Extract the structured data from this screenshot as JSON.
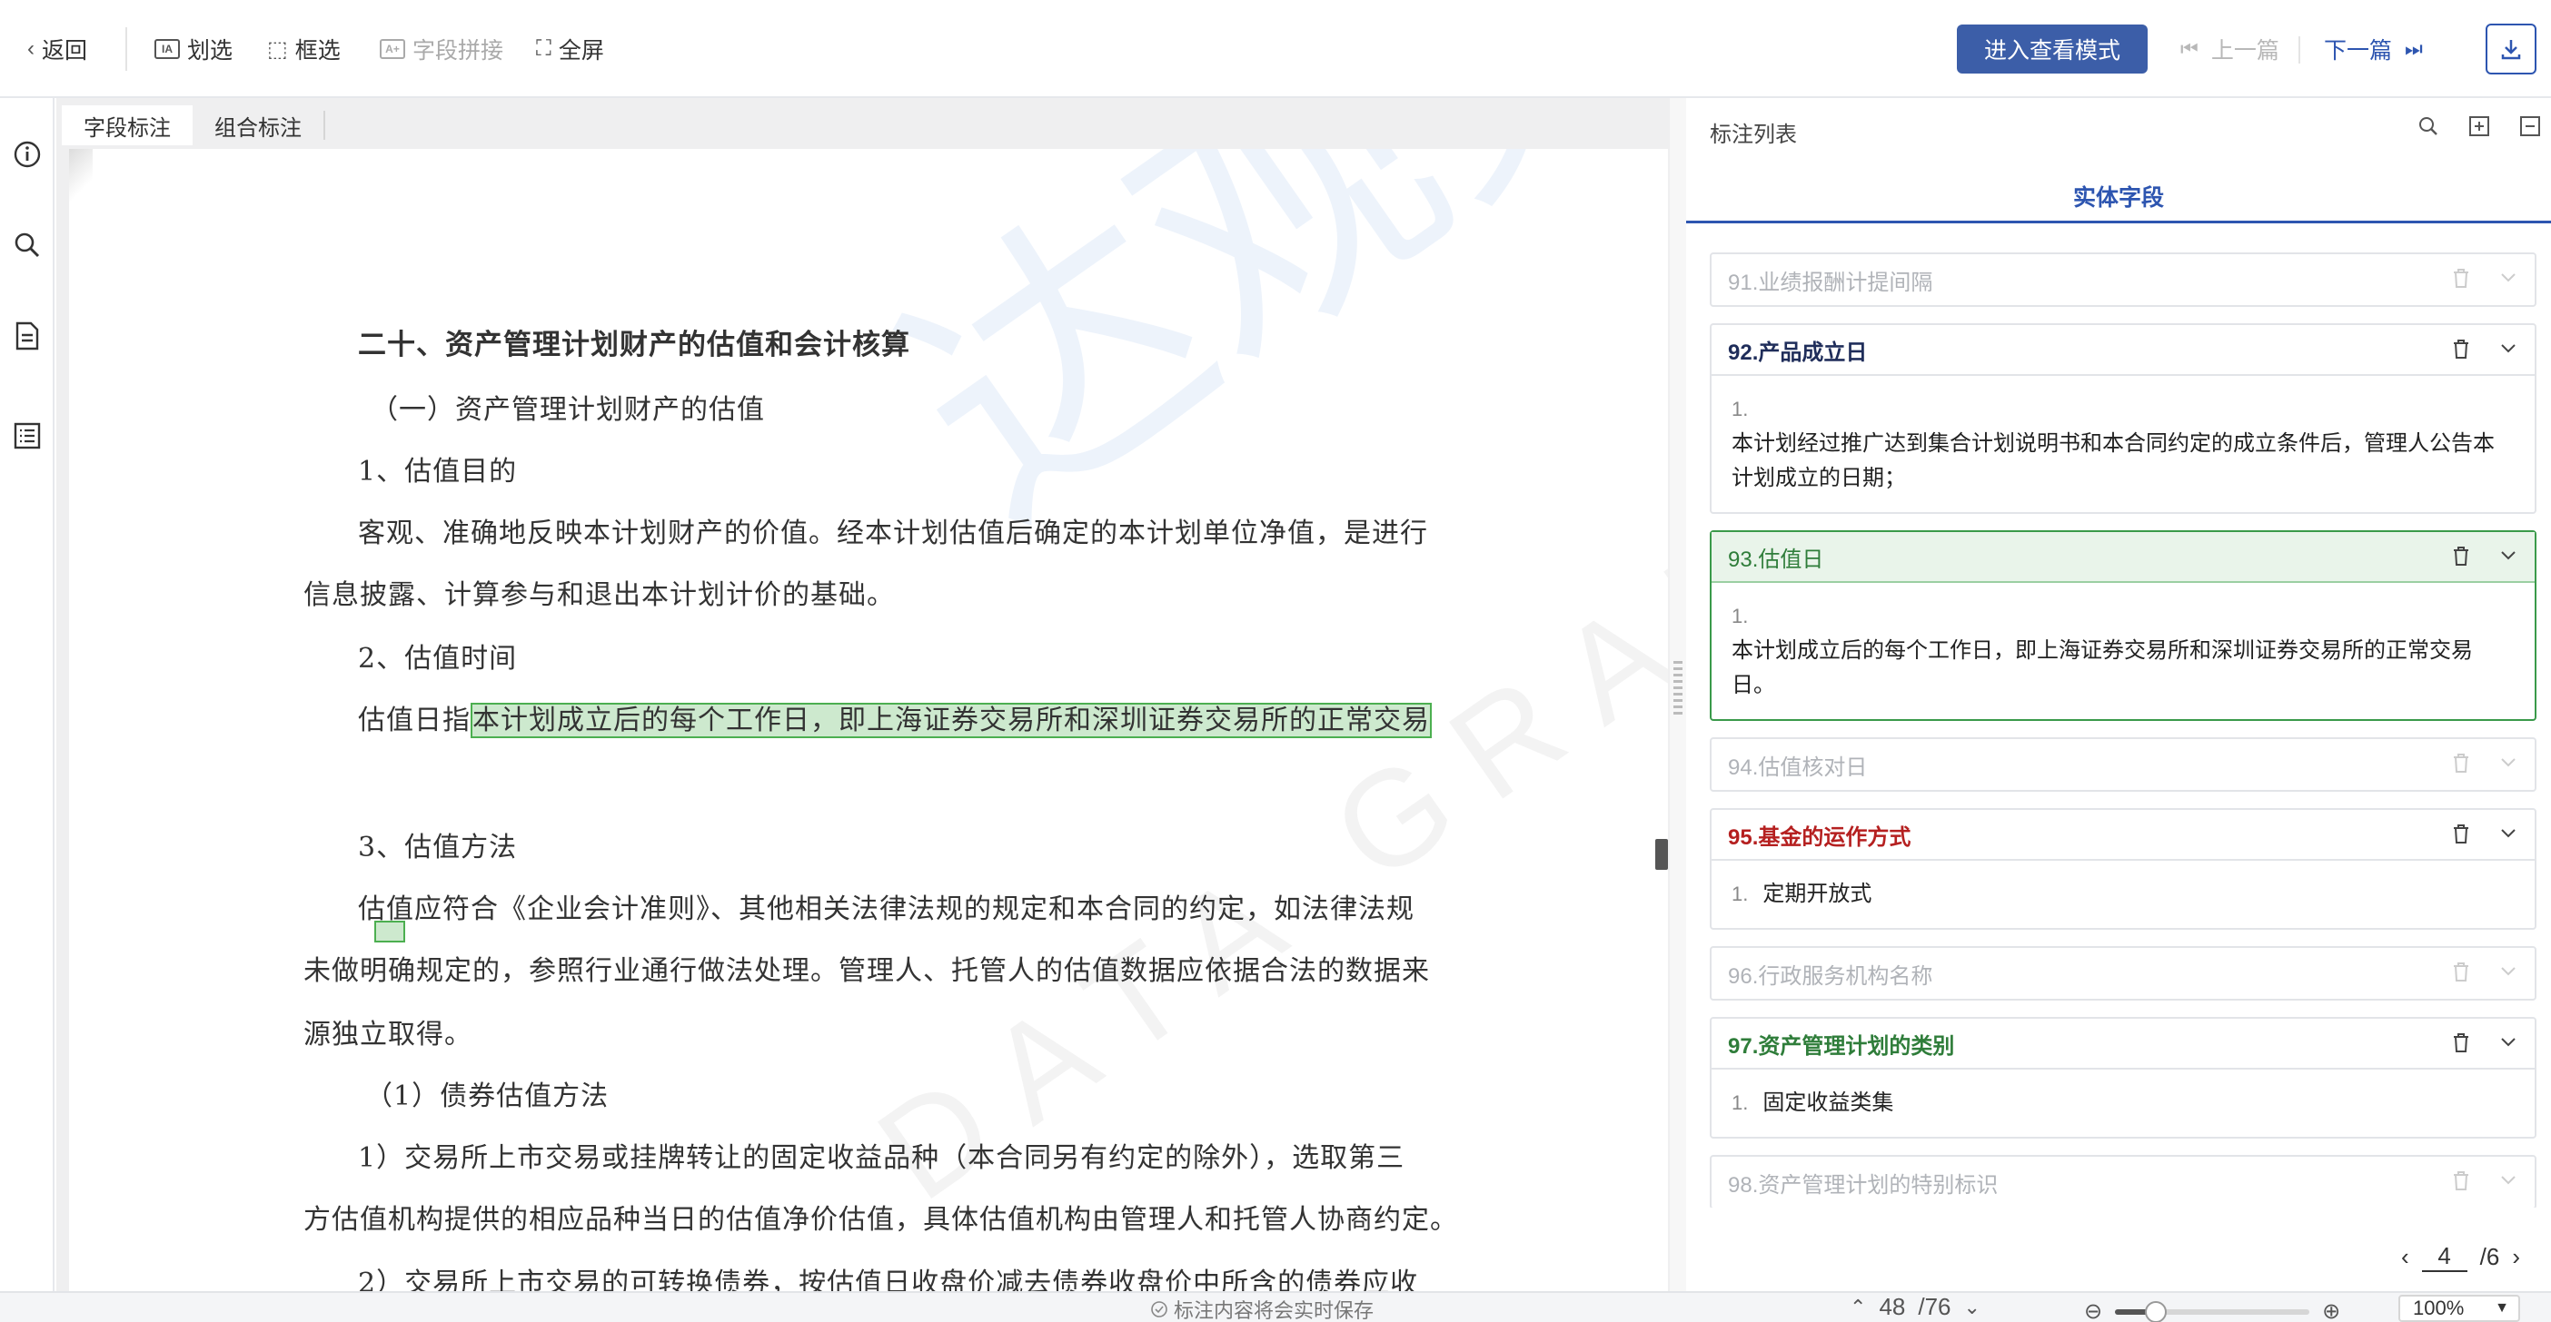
{
  "toolbar": {
    "back_label": "返回",
    "select_text_label": "划选",
    "box_select_label": "框选",
    "field_concat_label": "字段拼接",
    "fullscreen_label": "全屏",
    "view_mode_label": "进入查看模式",
    "prev_label": "上一篇",
    "next_label": "下一篇"
  },
  "doc_tabs": [
    {
      "label": "字段标注",
      "active": true
    },
    {
      "label": "组合标注",
      "active": false
    }
  ],
  "document": {
    "lines": [
      "二十、资产管理计划财产的估值和会计核算",
      "（一）资产管理计划财产的估值",
      "1、估值目的",
      "客观、准确地反映本计划财产的价值。经本计划估值后确定的本计划单位净值，是进行",
      "信息披露、计算参与和退出本计划计价的基础。",
      "2、估值时间",
      "估值日指",
      "本计划成立后的每个工作日，即上海证券交易所和深圳证券交易所的正常交易",
      "3、估值方法",
      "估值应符合《企业会计准则》、其他相关法律法规的规定和本合同的约定，如法律法规",
      "未做明确规定的，参照行业通行做法处理。管理人、托管人的估值数据应依据合法的数据来",
      "源独立取得。",
      "（1）债券估值方法",
      "1）交易所上市交易或挂牌转让的固定收益品种（本合同另有约定的除外），选取第三",
      "方估值机构提供的相应品种当日的估值净价估值，具体估值机构由管理人和托管人协商约定。",
      "2）交易所上市交易的可转换债券，按估值日收盘价减去债券收盘价中所含的债券应收"
    ]
  },
  "right_panel": {
    "title": "标注列表",
    "tab_label": "实体字段",
    "cards": [
      {
        "title": "91.业绩报酬计提间隔",
        "state": "collapsed",
        "num": "",
        "value": ""
      },
      {
        "title": "92.产品成立日",
        "state": "expanded",
        "color": "#1f2d5a",
        "num": "1.",
        "value": "本计划经过推广达到集合计划说明书和本合同约定的成立条件后，管理人公告本计划成立的日期；"
      },
      {
        "title": "93.估值日",
        "state": "active",
        "color": "#2f7d3a",
        "num": "1.",
        "value": "本计划成立后的每个工作日，即上海证券交易所和深圳证券交易所的正常交易日。"
      },
      {
        "title": "94.估值核对日",
        "state": "collapsed",
        "num": "",
        "value": ""
      },
      {
        "title": "95.基金的运作方式",
        "state": "expanded",
        "color": "#b52020",
        "num": "1.",
        "value": "定期开放式"
      },
      {
        "title": "96.行政服务机构名称",
        "state": "collapsed",
        "num": "",
        "value": ""
      },
      {
        "title": "97.资产管理计划的类别",
        "state": "expanded",
        "color": "#2f7d3a",
        "num": "1.",
        "value": "固定收益类集"
      },
      {
        "title": "98.资产管理计划的特别标识",
        "state": "collapsed",
        "num": "",
        "value": ""
      }
    ],
    "pagination": {
      "current": "4",
      "total": "/6"
    }
  },
  "status": {
    "save_notice": "标注内容将会实时保存",
    "current_page": "48",
    "total_pages": "/76",
    "zoom": "100%",
    "zoom_fraction": 0.21
  },
  "watermark": {
    "line1": "达观数据",
    "line2": "DATA GRAND"
  },
  "colors": {
    "primary": "#3c5ea8",
    "link": "#2d55b0",
    "highlight": "#4caf50"
  }
}
